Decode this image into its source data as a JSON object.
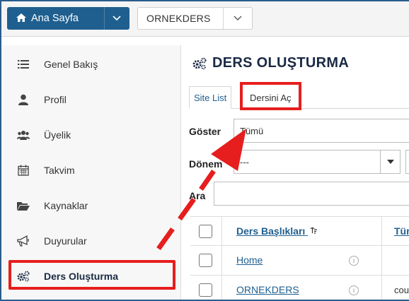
{
  "topbar": {
    "home_label": "Ana Sayfa",
    "site_label": "ORNEKDERS"
  },
  "sidebar": {
    "items": [
      {
        "label": "Genel Bakış",
        "icon": "list-icon"
      },
      {
        "label": "Profil",
        "icon": "user-icon"
      },
      {
        "label": "Üyelik",
        "icon": "users-icon"
      },
      {
        "label": "Takvim",
        "icon": "calendar-icon"
      },
      {
        "label": "Kaynaklar",
        "icon": "folder-icon"
      },
      {
        "label": "Duyurular",
        "icon": "bullhorn-icon"
      },
      {
        "label": "Ders Oluşturma",
        "icon": "gears-icon",
        "active": true
      }
    ]
  },
  "main": {
    "title": "DERS OLUŞTURMA",
    "tabs": [
      {
        "label": "Site List"
      },
      {
        "label": "Dersini Aç"
      }
    ],
    "filters": {
      "goster_label": "Göster",
      "goster_value": "Tümü",
      "donem_label": "Dönem",
      "donem_value": "---",
      "ara_label": "Ara"
    },
    "table": {
      "col1": "Ders Başlıkları",
      "col2": "Tür",
      "rows": [
        {
          "title": "Home",
          "type": ""
        },
        {
          "title": "ORNEKDERS",
          "type": "cou"
        }
      ]
    }
  },
  "colors": {
    "brand": "#1f5f8f",
    "highlight": "#e61e1e"
  }
}
